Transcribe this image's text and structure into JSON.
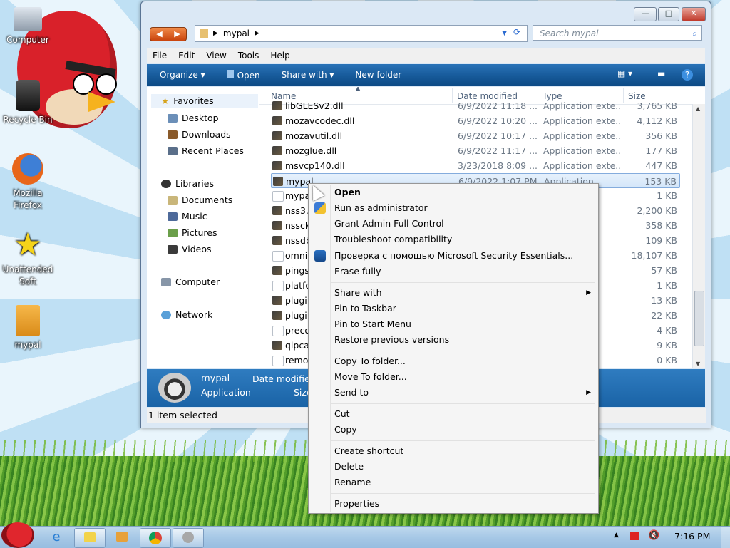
{
  "desktop": {
    "icons": [
      {
        "label": "Computer"
      },
      {
        "label": "Recycle Bin"
      },
      {
        "label": "Mozilla Firefox"
      },
      {
        "label": "Unattended Soft"
      },
      {
        "label": "mypal"
      }
    ]
  },
  "window": {
    "buttons": {
      "minimize": "—",
      "maximize": "□",
      "close": "✕"
    },
    "address": {
      "segment": "mypal"
    },
    "search": {
      "placeholder": "Search mypal"
    },
    "menu": [
      "File",
      "Edit",
      "View",
      "Tools",
      "Help"
    ],
    "toolbar": {
      "organize": "Organize ▾",
      "open": "Open",
      "share_with": "Share with ▾",
      "new_folder": "New folder"
    },
    "nav": {
      "favorites": "Favorites",
      "desktop": "Desktop",
      "downloads": "Downloads",
      "recent": "Recent Places",
      "libraries": "Libraries",
      "documents": "Documents",
      "music": "Music",
      "pictures": "Pictures",
      "videos": "Videos",
      "computer": "Computer",
      "network": "Network"
    },
    "columns": {
      "name": "Name",
      "date": "Date modified",
      "type": "Type",
      "size": "Size"
    },
    "files": [
      {
        "name": "libGLESv2.dll",
        "date": "6/9/2022 11:18 ...",
        "type": "Application exte...",
        "size": "3,765 KB"
      },
      {
        "name": "mozavcodec.dll",
        "date": "6/9/2022 10:20 ...",
        "type": "Application exte...",
        "size": "4,112 KB"
      },
      {
        "name": "mozavutil.dll",
        "date": "6/9/2022 10:17 ...",
        "type": "Application exte...",
        "size": "356 KB"
      },
      {
        "name": "mozglue.dll",
        "date": "6/9/2022 11:17 ...",
        "type": "Application exte...",
        "size": "177 KB"
      },
      {
        "name": "msvcp140.dll",
        "date": "3/23/2018 8:09 ...",
        "type": "Application exte...",
        "size": "447 KB"
      },
      {
        "name": "mypal",
        "date": "6/9/2022 1:07 PM",
        "type": "Application",
        "size": "153 KB"
      },
      {
        "name": "mypal",
        "date": "",
        "type": "nt",
        "size": "1 KB"
      },
      {
        "name": "nss3.",
        "date": "",
        "type": "xte...",
        "size": "2,200 KB"
      },
      {
        "name": "nssck",
        "date": "",
        "type": "xte...",
        "size": "358 KB"
      },
      {
        "name": "nssdb",
        "date": "",
        "type": "xte...",
        "size": "109 KB"
      },
      {
        "name": "omni",
        "date": "",
        "type": "",
        "size": "18,107 KB"
      },
      {
        "name": "pingse",
        "date": "",
        "type": "xte...",
        "size": "57 KB"
      },
      {
        "name": "platfo",
        "date": "",
        "type": "n se...",
        "size": "1 KB"
      },
      {
        "name": "plugi",
        "date": "",
        "type": "xte...",
        "size": "13 KB"
      },
      {
        "name": "plugi",
        "date": "",
        "type": "xte...",
        "size": "22 KB"
      },
      {
        "name": "preco",
        "date": "",
        "type": "",
        "size": "4 KB"
      },
      {
        "name": "qipca",
        "date": "",
        "type": "xte...",
        "size": "9 KB"
      },
      {
        "name": "remo",
        "date": "",
        "type": "",
        "size": "0 KB"
      }
    ],
    "details": {
      "name": "mypal",
      "type": "Application",
      "date_label": "Date modified",
      "size_label": "Size"
    },
    "status": "1 item selected"
  },
  "context_menu": {
    "items": [
      "Open",
      "Run as administrator",
      "Grant Admin Full Control",
      "Troubleshoot compatibility",
      "Проверка с помощью Microsoft Security Essentials...",
      "Erase fully",
      "Share with",
      "Pin to Taskbar",
      "Pin to Start Menu",
      "Restore previous versions",
      "Copy To folder...",
      "Move To folder...",
      "Send to",
      "Cut",
      "Copy",
      "Create shortcut",
      "Delete",
      "Rename",
      "Properties"
    ]
  },
  "taskbar": {
    "clock": "7:16 PM"
  }
}
